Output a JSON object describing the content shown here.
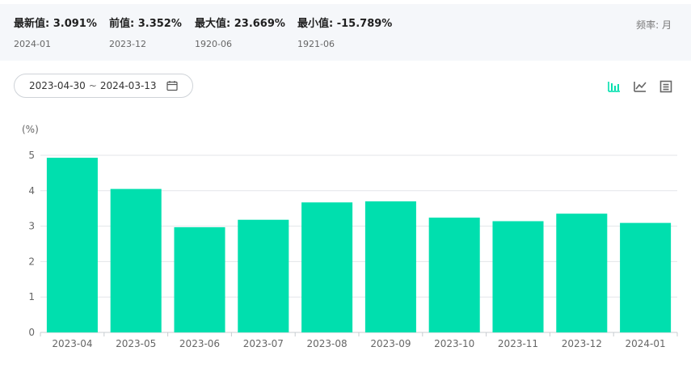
{
  "stats": {
    "latest": {
      "label": "最新值: ",
      "value": "3.091%",
      "date": "2024-01"
    },
    "previous": {
      "label": "前值: ",
      "value": "3.352%",
      "date": "2023-12"
    },
    "max": {
      "label": "最大值: ",
      "value": "23.669%",
      "date": "1920-06"
    },
    "min": {
      "label": "最小值: ",
      "value": "-15.789%",
      "date": "1921-06"
    },
    "frequency": "频率: 月"
  },
  "date_range": {
    "start": "2023-04-30",
    "separator": "~",
    "end": "2024-03-13",
    "icon": "calendar-icon"
  },
  "view_icons": [
    "bar-chart-icon",
    "line-chart-icon",
    "table-icon"
  ],
  "colors": {
    "accent": "#00dfae",
    "grid": "#e3e6ea",
    "axis": "#c8ccd1"
  },
  "chart_data": {
    "type": "bar",
    "unit": "(%)",
    "categories": [
      "2023-04",
      "2023-05",
      "2023-06",
      "2023-07",
      "2023-08",
      "2023-09",
      "2023-10",
      "2023-11",
      "2023-12",
      "2024-01"
    ],
    "values": [
      4.93,
      4.05,
      2.97,
      3.18,
      3.67,
      3.7,
      3.24,
      3.14,
      3.352,
      3.091
    ],
    "ylim": [
      0,
      5
    ],
    "yticks": [
      0,
      1,
      2,
      3,
      4,
      5
    ],
    "grid": true
  }
}
